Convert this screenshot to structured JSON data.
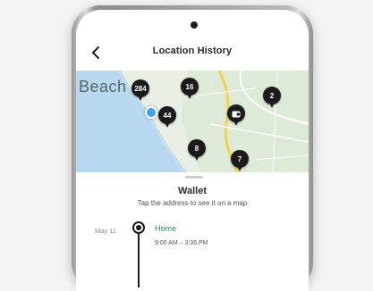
{
  "header": {
    "title": "Location History",
    "back_icon": "chevron-left-icon"
  },
  "map": {
    "label": "Beach",
    "pins": [
      {
        "count": "284"
      },
      {
        "count": "16"
      },
      {
        "count": "44"
      },
      {
        "count": "8"
      },
      {
        "count": "7"
      },
      {
        "count": "2"
      },
      {
        "count": "",
        "icon": "wallet-icon"
      }
    ],
    "current_location": "blue-dot"
  },
  "sheet": {
    "title": "Wallet",
    "subtitle": "Tap the address to see it on a map",
    "entries": [
      {
        "date": "May 11",
        "place": "Home",
        "time": "9:00 AM – 3:36 PM"
      }
    ]
  },
  "colors": {
    "accent_green": "#2f8f5a",
    "pin": "#1b1b1b",
    "water": "#b8d8ef",
    "road": "#f3d34a",
    "location_dot": "#3fa3e8"
  }
}
